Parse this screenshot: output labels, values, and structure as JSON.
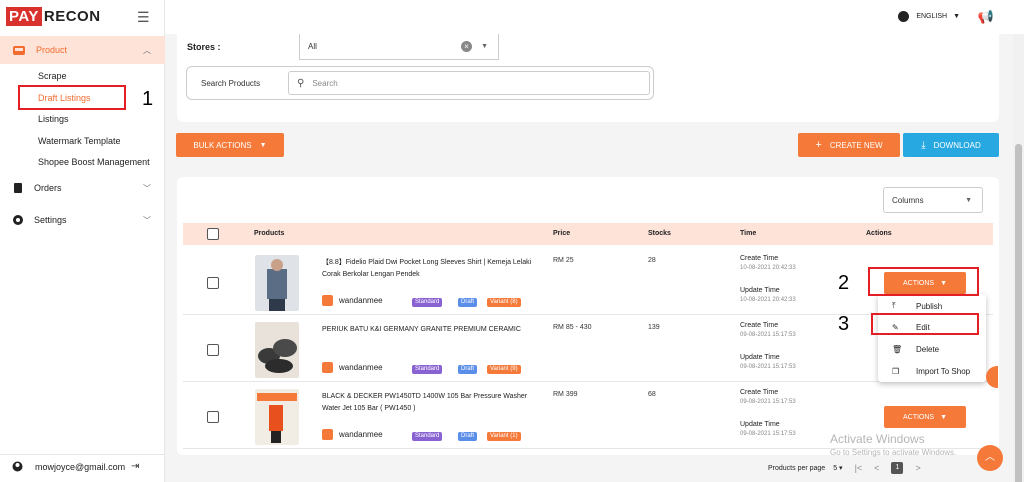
{
  "brand": {
    "pay": "PAY",
    "recon": "RECON"
  },
  "sidebar": {
    "product_label": "Product",
    "sub_items": [
      "Scrape",
      "Draft Listings",
      "Listings",
      "Watermark Template",
      "Shopee Boost Management"
    ],
    "orders_label": "Orders",
    "settings_label": "Settings",
    "user_email": "mowjoyce@gmail.com"
  },
  "topbar": {
    "language": "ENGLISH"
  },
  "filters": {
    "stores_label": "Stores :",
    "stores_value": "All",
    "search_label": "Search Products",
    "search_placeholder": "Search"
  },
  "toolbar": {
    "bulk_actions": "BULK ACTIONS",
    "create_new": "CREATE NEW",
    "download": "DOWNLOAD"
  },
  "table": {
    "columns_select": "Columns",
    "headers": {
      "products": "Products",
      "price": "Price",
      "stocks": "Stocks",
      "time": "Time",
      "actions": "Actions"
    },
    "create_time_label": "Create Time",
    "update_time_label": "Update Time",
    "actions_label": "ACTIONS",
    "badge_standard": "Standard",
    "badge_draft": "Draft",
    "rows": [
      {
        "name": "【8.8】Fidelio Plaid Dwi Pocket Long Sleeves Shirt | Kemeja Lelaki Corak Berkolar Lengan Pendek",
        "shop": "wandanmee",
        "variant": "Variant (8)",
        "price": "RM 25",
        "stocks": "28",
        "create_time": "10-08-2021 20:42:33",
        "update_time": "10-08-2021 20:42:33"
      },
      {
        "name": "PERIUK BATU K&I GERMANY GRANITE PREMIUM CERAMIC",
        "shop": "wandanmee",
        "variant": "Variant (9)",
        "price": "RM 85 - 430",
        "stocks": "139",
        "create_time": "09-08-2021 15:17:53",
        "update_time": "09-08-2021 15:17:53"
      },
      {
        "name": "BLACK & DECKER PW1450TD 1400W 105 Bar Pressure Washer Water Jet 105 Bar ( PW1450 )",
        "shop": "wandanmee",
        "variant": "Variant (1)",
        "price": "RM 399",
        "stocks": "68",
        "create_time": "09-08-2021 15:17:53",
        "update_time": "09-08-2021 15:17:53"
      }
    ]
  },
  "actions_menu": [
    "Publish",
    "Edit",
    "Delete",
    "Import To Shop"
  ],
  "pagination": {
    "label": "Products per page",
    "per_page": "5",
    "current": "1"
  },
  "annotations": [
    "1",
    "2",
    "3"
  ],
  "watermark": {
    "line1": "Activate Windows",
    "line2": "Go to Settings to activate Windows."
  },
  "colors": {
    "accent": "#f57a3a",
    "blue": "#27a8e0",
    "brand_red": "#d9312b",
    "annotation_red": "#e31e24"
  }
}
